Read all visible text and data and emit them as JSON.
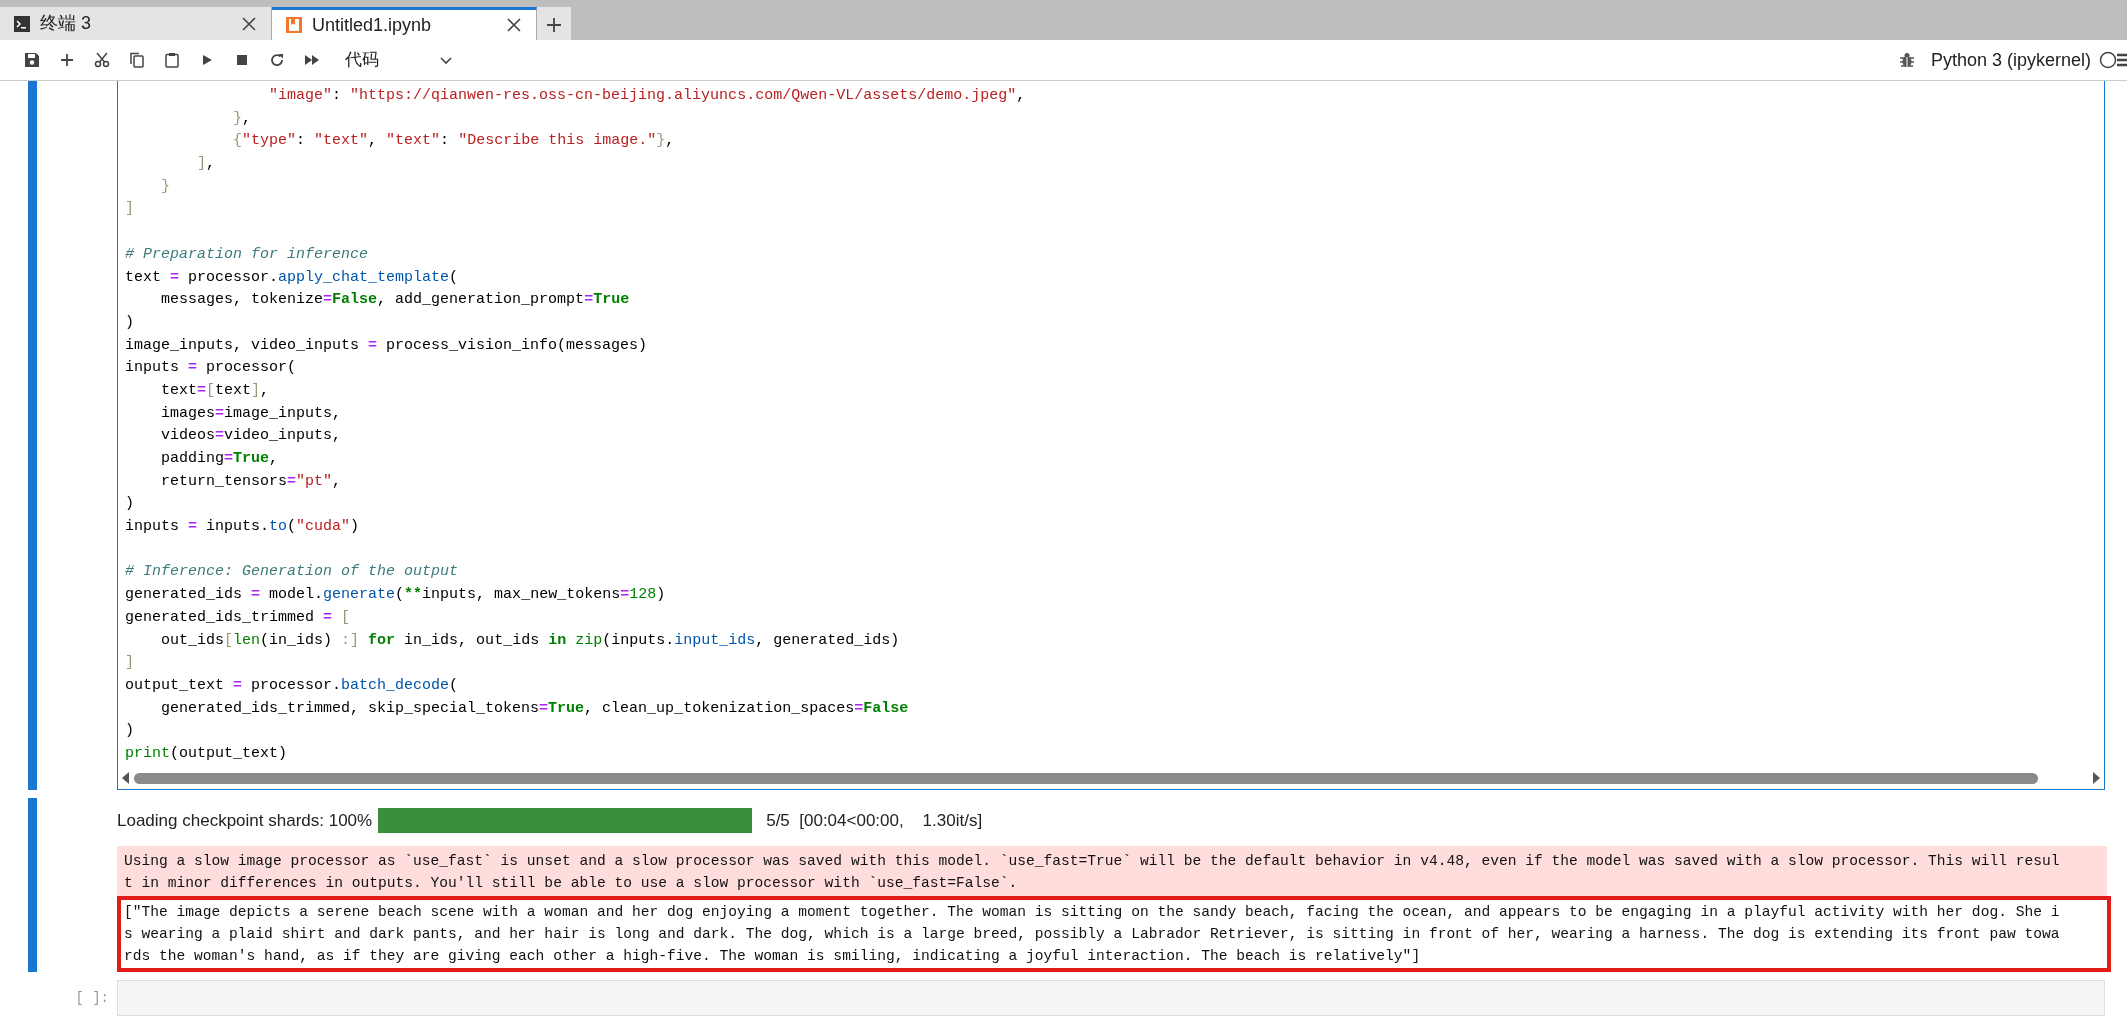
{
  "tabs": [
    {
      "kind": "terminal",
      "label": "终端 3",
      "selected": false
    },
    {
      "kind": "notebook",
      "label": "Untitled1.ipynb",
      "selected": true
    }
  ],
  "toolbar": {
    "cell_type": "代码",
    "kernel": "Python 3 (ipykernel)",
    "kernel_idle": true
  },
  "code_cell": {
    "lines": [
      {
        "kind": "code",
        "tokens": [
          {
            "kind": "str",
            "text": "                \"image\""
          },
          {
            "kind": "plain",
            "text": ": "
          },
          {
            "kind": "str",
            "text": "\"https://qianwen-res.oss-cn-beijing.aliyuncs.com/Qwen-VL/assets/demo.jpeg\""
          },
          {
            "kind": "plain",
            "text": ","
          }
        ]
      },
      {
        "kind": "code",
        "tokens": [
          {
            "kind": "br",
            "text": "            }"
          },
          {
            "kind": "plain",
            "text": ","
          }
        ]
      },
      {
        "kind": "code",
        "tokens": [
          {
            "kind": "br",
            "text": "            {"
          },
          {
            "kind": "str",
            "text": "\"type\""
          },
          {
            "kind": "plain",
            "text": ": "
          },
          {
            "kind": "str",
            "text": "\"text\""
          },
          {
            "kind": "plain",
            "text": ", "
          },
          {
            "kind": "str",
            "text": "\"text\""
          },
          {
            "kind": "plain",
            "text": ": "
          },
          {
            "kind": "str",
            "text": "\"Describe this image.\""
          },
          {
            "kind": "br",
            "text": "}"
          },
          {
            "kind": "plain",
            "text": ","
          }
        ]
      },
      {
        "kind": "code",
        "tokens": [
          {
            "kind": "br",
            "text": "        ]"
          },
          {
            "kind": "plain",
            "text": ","
          }
        ]
      },
      {
        "kind": "code",
        "tokens": [
          {
            "kind": "br",
            "text": "    }"
          }
        ]
      },
      {
        "kind": "code",
        "tokens": [
          {
            "kind": "br",
            "text": "]"
          }
        ]
      },
      {
        "kind": "blank"
      },
      {
        "kind": "code",
        "tokens": [
          {
            "kind": "cmt",
            "text": "# Preparation for inference"
          }
        ]
      },
      {
        "kind": "code",
        "tokens": [
          {
            "kind": "plain",
            "text": "text "
          },
          {
            "kind": "op",
            "text": "="
          },
          {
            "kind": "plain",
            "text": " processor."
          },
          {
            "kind": "fn",
            "text": "apply_chat_template"
          },
          {
            "kind": "plain",
            "text": "("
          }
        ]
      },
      {
        "kind": "code",
        "tokens": [
          {
            "kind": "plain",
            "text": "    messages, tokenize"
          },
          {
            "kind": "op",
            "text": "="
          },
          {
            "kind": "kw",
            "text": "False"
          },
          {
            "kind": "plain",
            "text": ", add_generation_prompt"
          },
          {
            "kind": "op",
            "text": "="
          },
          {
            "kind": "kw",
            "text": "True"
          }
        ]
      },
      {
        "kind": "code",
        "tokens": [
          {
            "kind": "plain",
            "text": ")"
          }
        ]
      },
      {
        "kind": "code",
        "tokens": [
          {
            "kind": "plain",
            "text": "image_inputs, video_inputs "
          },
          {
            "kind": "op",
            "text": "="
          },
          {
            "kind": "plain",
            "text": " process_vision_info(messages)"
          }
        ]
      },
      {
        "kind": "code",
        "tokens": [
          {
            "kind": "plain",
            "text": "inputs "
          },
          {
            "kind": "op",
            "text": "="
          },
          {
            "kind": "plain",
            "text": " processor("
          }
        ]
      },
      {
        "kind": "code",
        "tokens": [
          {
            "kind": "plain",
            "text": "    text"
          },
          {
            "kind": "op",
            "text": "="
          },
          {
            "kind": "br",
            "text": "["
          },
          {
            "kind": "plain",
            "text": "text"
          },
          {
            "kind": "br",
            "text": "]"
          },
          {
            "kind": "plain",
            "text": ","
          }
        ]
      },
      {
        "kind": "code",
        "tokens": [
          {
            "kind": "plain",
            "text": "    images"
          },
          {
            "kind": "op",
            "text": "="
          },
          {
            "kind": "plain",
            "text": "image_inputs,"
          }
        ]
      },
      {
        "kind": "code",
        "tokens": [
          {
            "kind": "plain",
            "text": "    videos"
          },
          {
            "kind": "op",
            "text": "="
          },
          {
            "kind": "plain",
            "text": "video_inputs,"
          }
        ]
      },
      {
        "kind": "code",
        "tokens": [
          {
            "kind": "plain",
            "text": "    padding"
          },
          {
            "kind": "op",
            "text": "="
          },
          {
            "kind": "kw",
            "text": "True"
          },
          {
            "kind": "plain",
            "text": ","
          }
        ]
      },
      {
        "kind": "code",
        "tokens": [
          {
            "kind": "plain",
            "text": "    return_tensors"
          },
          {
            "kind": "op",
            "text": "="
          },
          {
            "kind": "str",
            "text": "\"pt\""
          },
          {
            "kind": "plain",
            "text": ","
          }
        ]
      },
      {
        "kind": "code",
        "tokens": [
          {
            "kind": "plain",
            "text": ")"
          }
        ]
      },
      {
        "kind": "code",
        "tokens": [
          {
            "kind": "plain",
            "text": "inputs "
          },
          {
            "kind": "op",
            "text": "="
          },
          {
            "kind": "plain",
            "text": " inputs."
          },
          {
            "kind": "fn",
            "text": "to"
          },
          {
            "kind": "plain",
            "text": "("
          },
          {
            "kind": "str",
            "text": "\"cuda\""
          },
          {
            "kind": "plain",
            "text": ")"
          }
        ]
      },
      {
        "kind": "blank"
      },
      {
        "kind": "code",
        "tokens": [
          {
            "kind": "cmt",
            "text": "# Inference: Generation of the output"
          }
        ]
      },
      {
        "kind": "code",
        "tokens": [
          {
            "kind": "plain",
            "text": "generated_ids "
          },
          {
            "kind": "op",
            "text": "="
          },
          {
            "kind": "plain",
            "text": " model."
          },
          {
            "kind": "fn",
            "text": "generate"
          },
          {
            "kind": "plain",
            "text": "("
          },
          {
            "kind": "kw",
            "text": "**"
          },
          {
            "kind": "plain",
            "text": "inputs, max_new_tokens"
          },
          {
            "kind": "op",
            "text": "="
          },
          {
            "kind": "bi",
            "text": "128"
          },
          {
            "kind": "plain",
            "text": ")"
          }
        ]
      },
      {
        "kind": "code",
        "tokens": [
          {
            "kind": "plain",
            "text": "generated_ids_trimmed "
          },
          {
            "kind": "op",
            "text": "="
          },
          {
            "kind": "br",
            "text": " ["
          }
        ]
      },
      {
        "kind": "code",
        "tokens": [
          {
            "kind": "plain",
            "text": "    out_ids"
          },
          {
            "kind": "br",
            "text": "["
          },
          {
            "kind": "bi",
            "text": "len"
          },
          {
            "kind": "plain",
            "text": "(in_ids) "
          },
          {
            "kind": "br",
            "text": ":]"
          },
          {
            "kind": "kw",
            "text": " for"
          },
          {
            "kind": "plain",
            "text": " in_ids, out_ids "
          },
          {
            "kind": "kw",
            "text": "in"
          },
          {
            "kind": "bi",
            "text": " zip"
          },
          {
            "kind": "plain",
            "text": "(inputs."
          },
          {
            "kind": "fn",
            "text": "input_ids"
          },
          {
            "kind": "plain",
            "text": ", generated_ids)"
          }
        ]
      },
      {
        "kind": "code",
        "tokens": [
          {
            "kind": "br",
            "text": "]"
          }
        ]
      },
      {
        "kind": "code",
        "tokens": [
          {
            "kind": "plain",
            "text": "output_text "
          },
          {
            "kind": "op",
            "text": "="
          },
          {
            "kind": "plain",
            "text": " processor."
          },
          {
            "kind": "fn",
            "text": "batch_decode"
          },
          {
            "kind": "plain",
            "text": "("
          }
        ]
      },
      {
        "kind": "code",
        "tokens": [
          {
            "kind": "plain",
            "text": "    generated_ids_trimmed, skip_special_tokens"
          },
          {
            "kind": "op",
            "text": "="
          },
          {
            "kind": "kw",
            "text": "True"
          },
          {
            "kind": "plain",
            "text": ", clean_up_tokenization_spaces"
          },
          {
            "kind": "op",
            "text": "="
          },
          {
            "kind": "kw",
            "text": "False"
          }
        ]
      },
      {
        "kind": "code",
        "tokens": [
          {
            "kind": "plain",
            "text": ")"
          }
        ]
      },
      {
        "kind": "code",
        "tokens": [
          {
            "kind": "bi",
            "text": "print"
          },
          {
            "kind": "plain",
            "text": "(output_text)"
          }
        ]
      }
    ]
  },
  "output": {
    "progress": {
      "label": "Loading checkpoint shards: 100%",
      "level": 1,
      "stats": "5/5  [00:04<00:00,    1.30it/s]"
    },
    "stderr": [
      "Using a slow image processor as `use_fast` is unset and a slow processor was saved with this model. `use_fast=True` will be the default behavior in v4.48, even if the model was saved with a slow processor. This will resul",
      "t in minor differences in outputs. You'll still be able to use a slow processor with `use_fast=False`."
    ],
    "stdout": [
      "[\"The image depicts a serene beach scene with a woman and her dog enjoying a moment together. The woman is sitting on the sandy beach, facing the ocean, and appears to be engaging in a playful activity with her dog. She i",
      "s wearing a plaid shirt and dark pants, and her hair is long and dark. The dog, which is a large breed, possibly a Labrador Retriever, is sitting in front of her, wearing a harness. The dog is extending its front paw towa",
      "rds the woman's hand, as if they are giving each other a high-five. The woman is smiling, indicating a joyful interaction. The beach is relatively\"]"
    ]
  },
  "empty_cell": {
    "prompt": "[ ]:"
  }
}
